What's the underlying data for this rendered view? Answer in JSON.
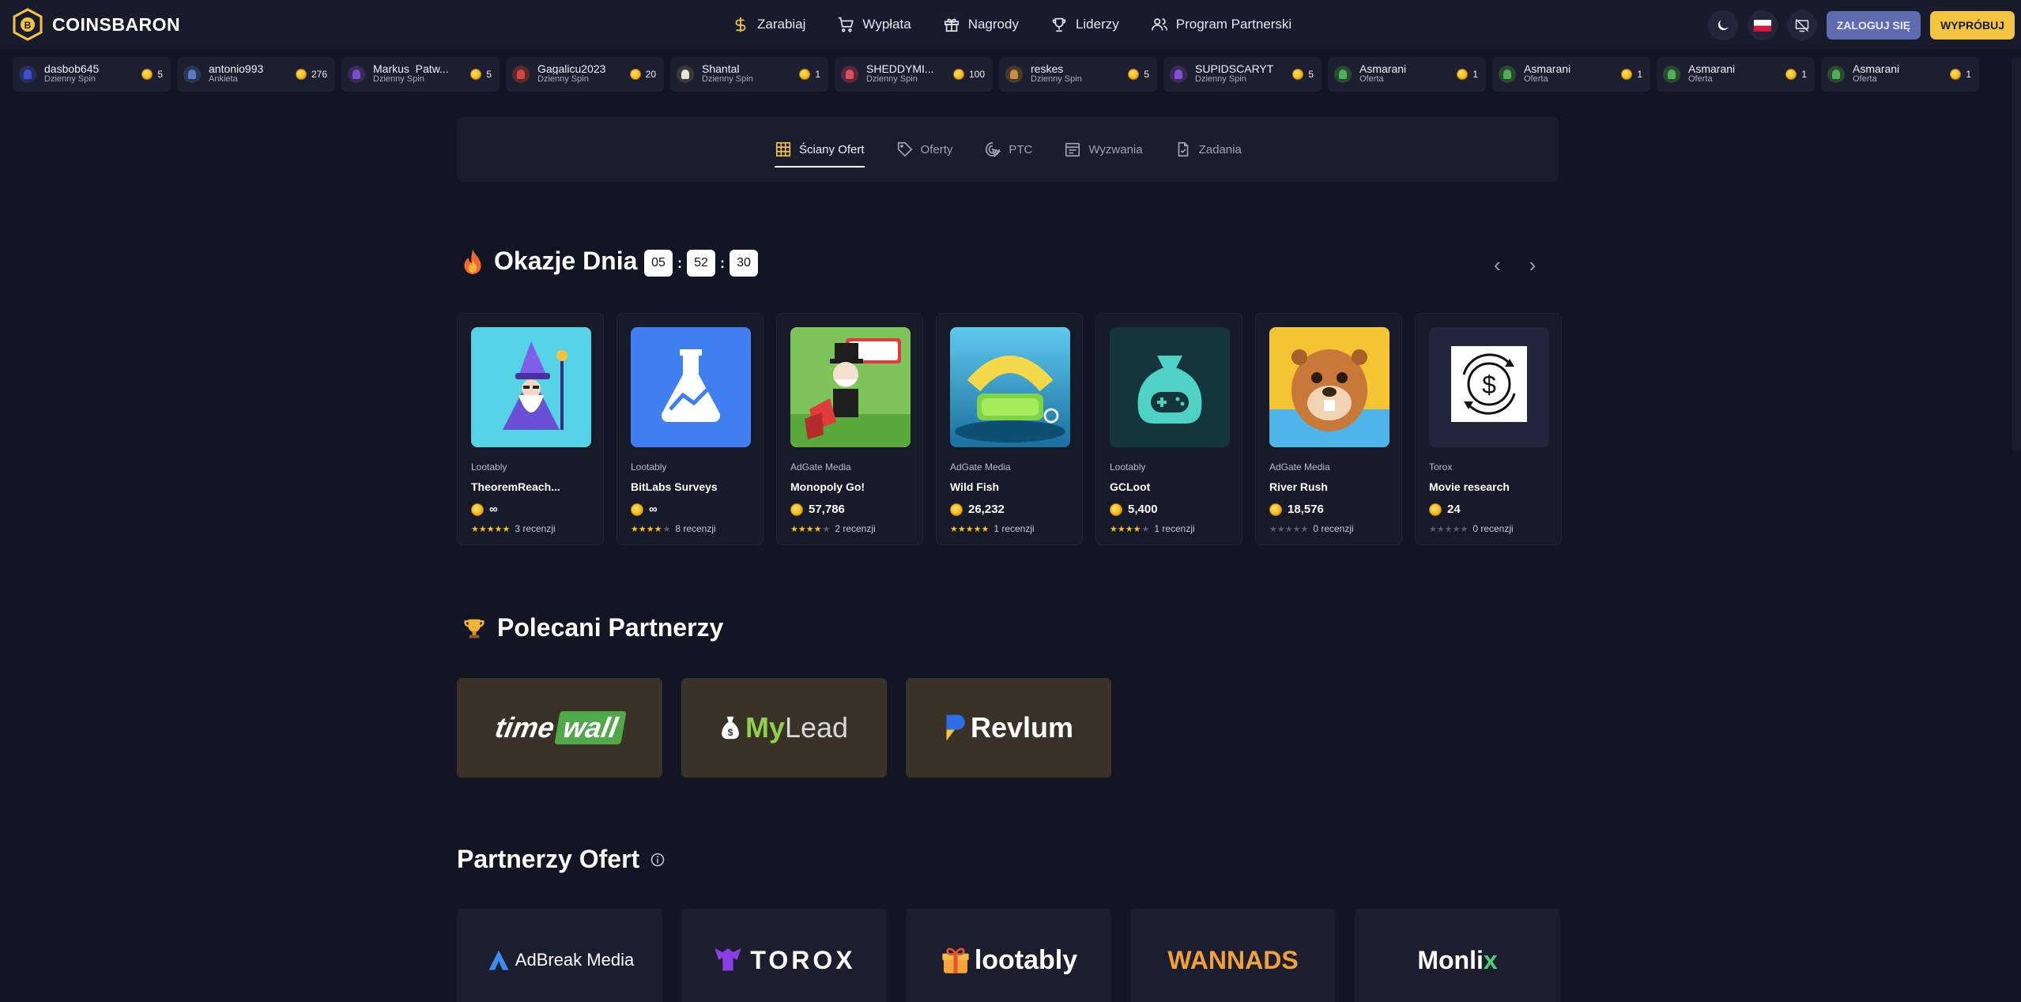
{
  "header": {
    "brand": "COINSBARON",
    "nav": [
      {
        "label": "Zarabiaj",
        "icon": "dollar-icon"
      },
      {
        "label": "Wypłata",
        "icon": "cart-icon"
      },
      {
        "label": "Nagrody",
        "icon": "gift-icon"
      },
      {
        "label": "Liderzy",
        "icon": "trophy-icon"
      },
      {
        "label": "Program Partnerski",
        "icon": "users-icon"
      }
    ],
    "login_label": "ZALOGUJ SIĘ",
    "try_label": "WYPRÓBUJ",
    "accent_colors": {
      "login": "#5e6bb0",
      "try": "#f2c440"
    }
  },
  "feed": [
    {
      "name": "dasbob645",
      "type": "Dzienny Spin",
      "amount": "5",
      "avatar_color": "#3d4fd6"
    },
    {
      "name": "antonio993",
      "type": "Ankieta",
      "amount": "276",
      "avatar_color": "#5a79c8"
    },
    {
      "name": "Markus_Patw...",
      "type": "Dzienny Spin",
      "amount": "5",
      "avatar_color": "#7b4fd0"
    },
    {
      "name": "Gagalicu2023",
      "type": "Dzienny Spin",
      "amount": "20",
      "avatar_color": "#d64545"
    },
    {
      "name": "Shantal",
      "type": "Dzienny Spin",
      "amount": "1",
      "avatar_color": "#e9e2d6"
    },
    {
      "name": "SHEDDYMI...",
      "type": "Dzienny Spin",
      "amount": "100",
      "avatar_color": "#e05060"
    },
    {
      "name": "reskes",
      "type": "Dzienny Spin",
      "amount": "5",
      "avatar_color": "#c98a4a"
    },
    {
      "name": "SUPIDSCARYT",
      "type": "Dzienny Spin",
      "amount": "5",
      "avatar_color": "#8a4fd6"
    },
    {
      "name": "Asmarani",
      "type": "Oferta",
      "amount": "1",
      "avatar_color": "#4fae5a"
    },
    {
      "name": "Asmarani",
      "type": "Oferta",
      "amount": "1",
      "avatar_color": "#4fae5a"
    },
    {
      "name": "Asmarani",
      "type": "Oferta",
      "amount": "1",
      "avatar_color": "#4fae5a"
    },
    {
      "name": "Asmarani",
      "type": "Oferta",
      "amount": "1",
      "avatar_color": "#4fae5a"
    }
  ],
  "tabs": [
    {
      "label": "Ściany Ofert",
      "icon": "grid-icon",
      "active": true
    },
    {
      "label": "Oferty",
      "icon": "tag-icon",
      "active": false
    },
    {
      "label": "PTC",
      "icon": "cursor-click-icon",
      "active": false
    },
    {
      "label": "Wyzwania",
      "icon": "calendar-icon",
      "active": false
    },
    {
      "label": "Zadania",
      "icon": "task-icon",
      "active": false
    }
  ],
  "deals": {
    "title": "Okazje Dnia",
    "timer": {
      "hours": "05",
      "minutes": "52",
      "seconds": "30"
    },
    "offers": [
      {
        "provider": "Lootably",
        "name": "TheoremReach...",
        "reward": "∞",
        "stars": 5,
        "reviews": "3 recenzji",
        "image": "wizard-icon"
      },
      {
        "provider": "Lootably",
        "name": "BitLabs Surveys",
        "reward": "∞",
        "stars": 3.5,
        "reviews": "8 recenzji",
        "image": "flask-icon"
      },
      {
        "provider": "AdGate Media",
        "name": "Monopoly Go!",
        "reward": "57,786",
        "stars": 3.5,
        "reviews": "2 recenzji",
        "image": "monopoly-image"
      },
      {
        "provider": "AdGate Media",
        "name": "Wild Fish",
        "reward": "26,232",
        "stars": 5,
        "reviews": "1 recenzji",
        "image": "wild-fish-image"
      },
      {
        "provider": "Lootably",
        "name": "GCLoot",
        "reward": "5,400",
        "stars": 4,
        "reviews": "1 recenzji",
        "image": "gamepad-bag-icon"
      },
      {
        "provider": "AdGate Media",
        "name": "River Rush",
        "reward": "18,576",
        "stars": 0,
        "reviews": "0 recenzji",
        "image": "beaver-image"
      },
      {
        "provider": "Torox",
        "name": "Movie research",
        "reward": "24",
        "stars": 0,
        "reviews": "0 recenzji",
        "image": "dollar-cycle-icon"
      }
    ]
  },
  "recommended": {
    "title": "Polecani Partnerzy",
    "partners": [
      {
        "name": "timewall",
        "text_a": "time",
        "text_b": "wall"
      },
      {
        "name": "mylead",
        "text_a": "My",
        "text_b": "Lead"
      },
      {
        "name": "revlum",
        "text_a": "Revlum"
      }
    ]
  },
  "offer_partners": {
    "title": "Partnerzy Ofert",
    "partners": [
      {
        "name": "adbreak",
        "text": "AdBreak Media"
      },
      {
        "name": "torox",
        "text": "TOROX"
      },
      {
        "name": "lootably",
        "text": "lootably"
      },
      {
        "name": "wannads",
        "text": "WANNADS"
      },
      {
        "name": "monlix",
        "text_a": "Monli",
        "text_b": "x"
      }
    ]
  }
}
